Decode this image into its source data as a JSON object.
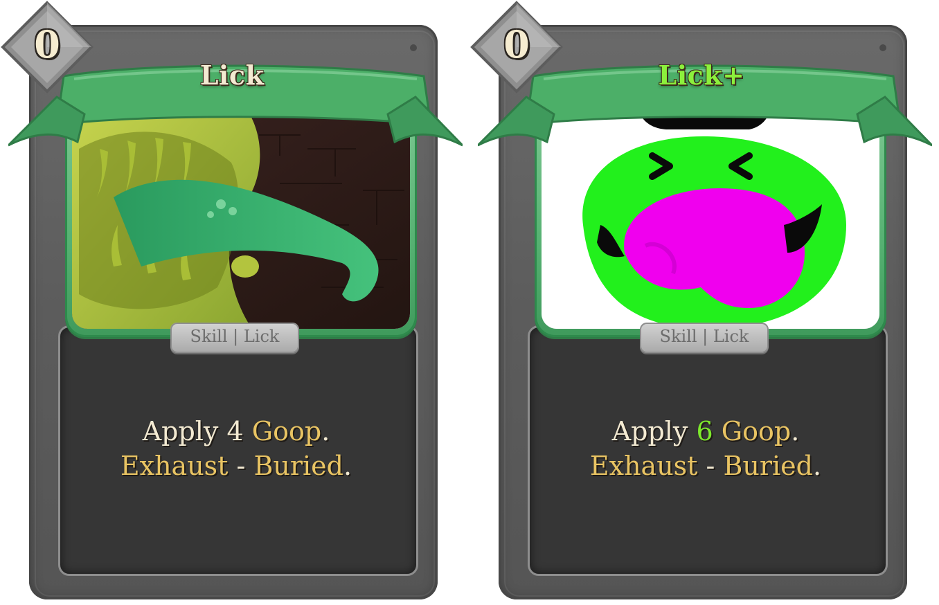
{
  "cards": [
    {
      "title": "Lick",
      "cost": "0",
      "type_line": "Skill | Lick",
      "description": {
        "line1": {
          "prefix": "Apply ",
          "amount": "4",
          "keyword": "Goop",
          "suffix": "."
        },
        "line2": {
          "keyword1": "Exhaust",
          "separator": " - ",
          "keyword2": "Buried",
          "suffix": "."
        }
      },
      "upgraded": false
    },
    {
      "title": "Lick+",
      "cost": "0",
      "type_line": "Skill | Lick",
      "description": {
        "line1": {
          "prefix": "Apply ",
          "amount": "6",
          "keyword": "Goop",
          "suffix": "."
        },
        "line2": {
          "keyword1": "Exhaust",
          "separator": " - ",
          "keyword2": "Buried",
          "suffix": "."
        }
      },
      "upgraded": true
    }
  ],
  "colors": {
    "banner_green": "#4caf68",
    "keyword_gold": "#e9c463",
    "upgrade_green": "#7dea2c",
    "card_gray": "#5e5e5e",
    "panel_dark": "#363636"
  }
}
